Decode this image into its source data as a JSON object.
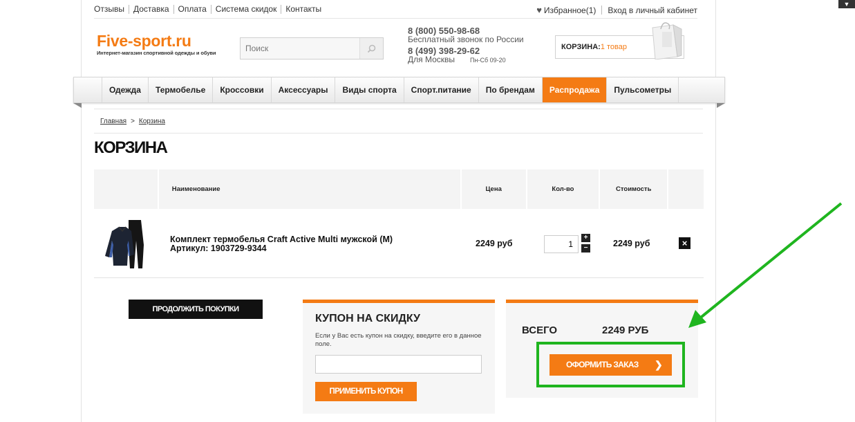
{
  "top_links": [
    "Отзывы",
    "Доставка",
    "Оплата",
    "Система скидок",
    "Контакты"
  ],
  "top_right": {
    "favorites": "Избранное(1)",
    "login": "Вход в личный кабинет"
  },
  "logo": {
    "name": "Five-sport.ru",
    "tagline": "Интернет-магазин спортивной одежды и обуви"
  },
  "search": {
    "placeholder": "Поиск"
  },
  "phones": {
    "phone1": "8 (800) 550-98-68",
    "phone1_note": "Бесплатный звонок по России",
    "phone2": "8 (499) 398-29-62",
    "phone2_note": "Для Москвы",
    "hours": "Пн-Сб 09-20"
  },
  "cart_widget": {
    "label": "КОРЗИНА:",
    "count": "1 товар"
  },
  "nav": [
    "Одежда",
    "Термобелье",
    "Кроссовки",
    "Аксессуары",
    "Виды спорта",
    "Спорт.питание",
    "По брендам",
    "Распродажа",
    "Пульсометры"
  ],
  "nav_active": "Распродажа",
  "breadcrumb": {
    "home": "Главная",
    "separator": ">",
    "current": "Корзина"
  },
  "page_title": "КОРЗИНА",
  "table": {
    "headers": {
      "name": "Наименование",
      "price": "Цена",
      "qty": "Кол-во",
      "cost": "Стоимость"
    },
    "rows": [
      {
        "name": "Комплект термобелья Craft Active Multi мужской (M)",
        "sku": "Артикул: 1903729-9344",
        "price": "2249 руб",
        "qty": "1",
        "cost": "2249 руб"
      }
    ]
  },
  "buttons": {
    "continue": "Продолжить покупки",
    "apply_coupon": "Применить купон",
    "checkout": "Оформить заказ"
  },
  "coupon": {
    "title": "КУПОН НА СКИДКУ",
    "text": "Если у Вас есть купон на скидку, введите его в данное поле."
  },
  "total": {
    "label": "ВСЕГО",
    "value": "2249 РУБ"
  },
  "colors": {
    "accent": "#f47b14",
    "highlight": "#1fb51f",
    "dark": "#111111"
  }
}
